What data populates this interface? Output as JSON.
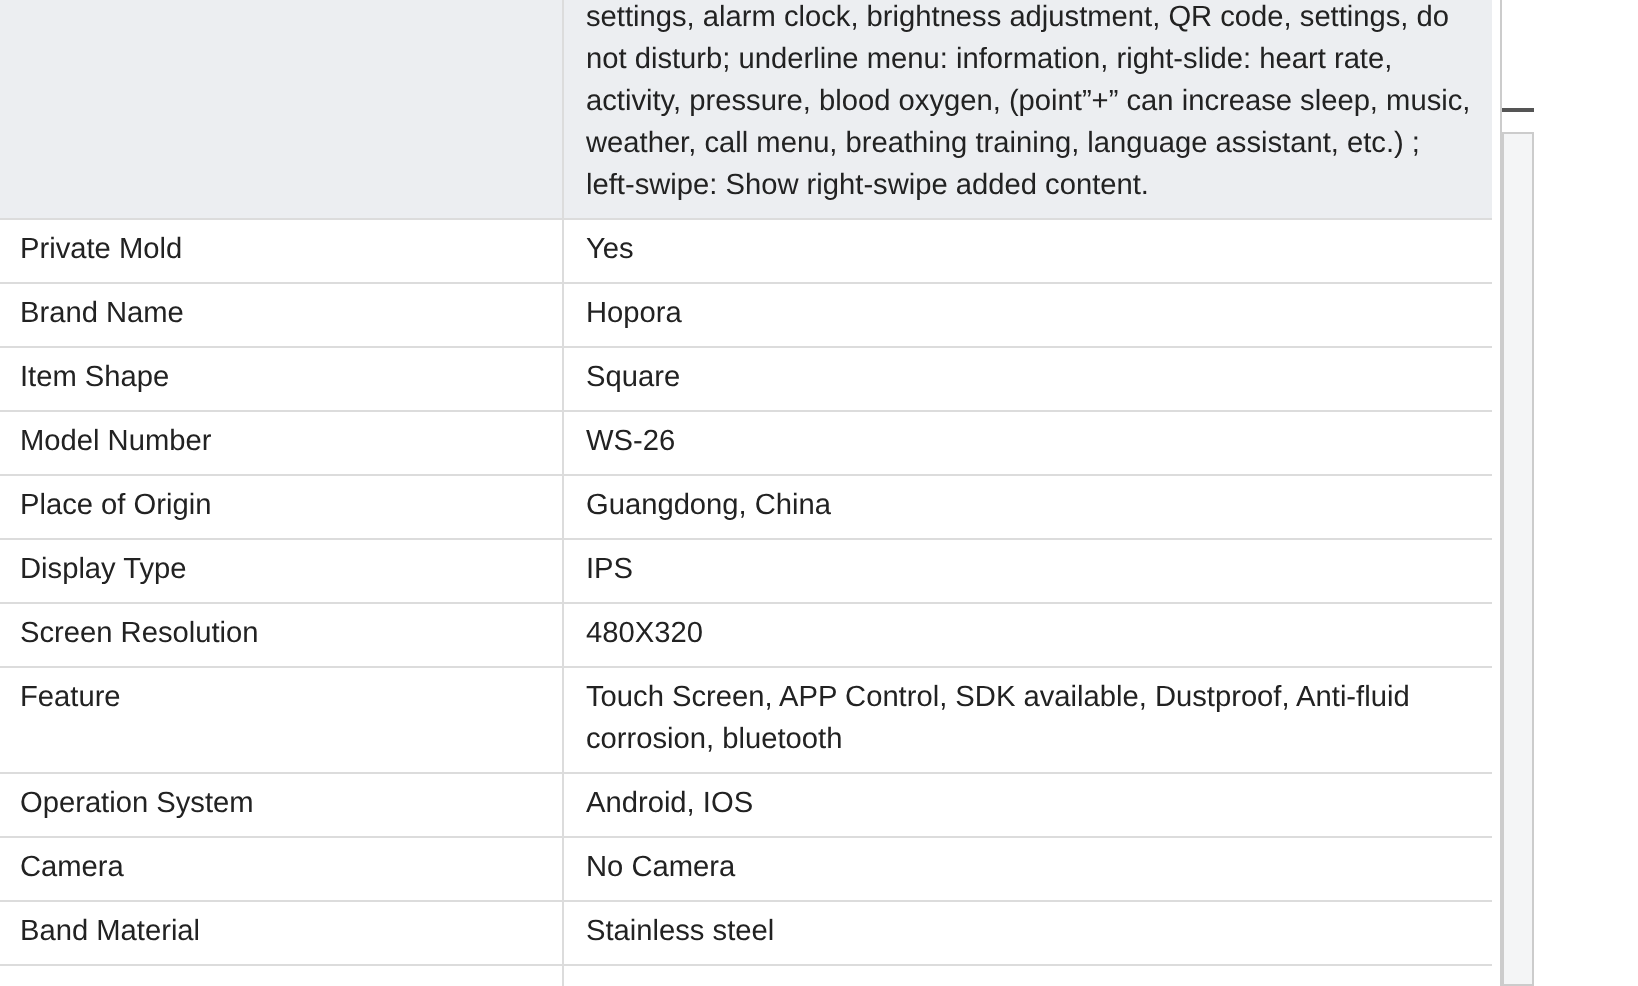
{
  "table": {
    "rows": [
      {
        "label": "",
        "value": "settings, alarm clock, brightness adjustment, QR code, settings, do not disturb; underline menu: information, right-slide: heart rate, activity, pressure, blood oxygen, (point”+” can increase sleep, music, weather, call menu, breathing training, language assistant, etc.) ; left-swipe: Show right-swipe added content.",
        "shaded": true
      },
      {
        "label": "Private Mold",
        "value": "Yes",
        "shaded": false
      },
      {
        "label": "Brand Name",
        "value": "Hopora",
        "shaded": false
      },
      {
        "label": "Item Shape",
        "value": "Square",
        "shaded": false
      },
      {
        "label": "Model Number",
        "value": "WS-26",
        "shaded": false
      },
      {
        "label": "Place of Origin",
        "value": "Guangdong, China",
        "shaded": false
      },
      {
        "label": "Display Type",
        "value": "IPS",
        "shaded": false
      },
      {
        "label": "Screen Resolution",
        "value": "480X320",
        "shaded": false
      },
      {
        "label": "Feature",
        "value": "Touch Screen, APP Control, SDK available, Dustproof, Anti-fluid corrosion, bluetooth",
        "shaded": false
      },
      {
        "label": "Operation System",
        "value": "Android, IOS",
        "shaded": false
      },
      {
        "label": "Camera",
        "value": "No Camera",
        "shaded": false
      },
      {
        "label": "Band Material",
        "value": "Stainless steel",
        "shaded": false
      }
    ]
  }
}
